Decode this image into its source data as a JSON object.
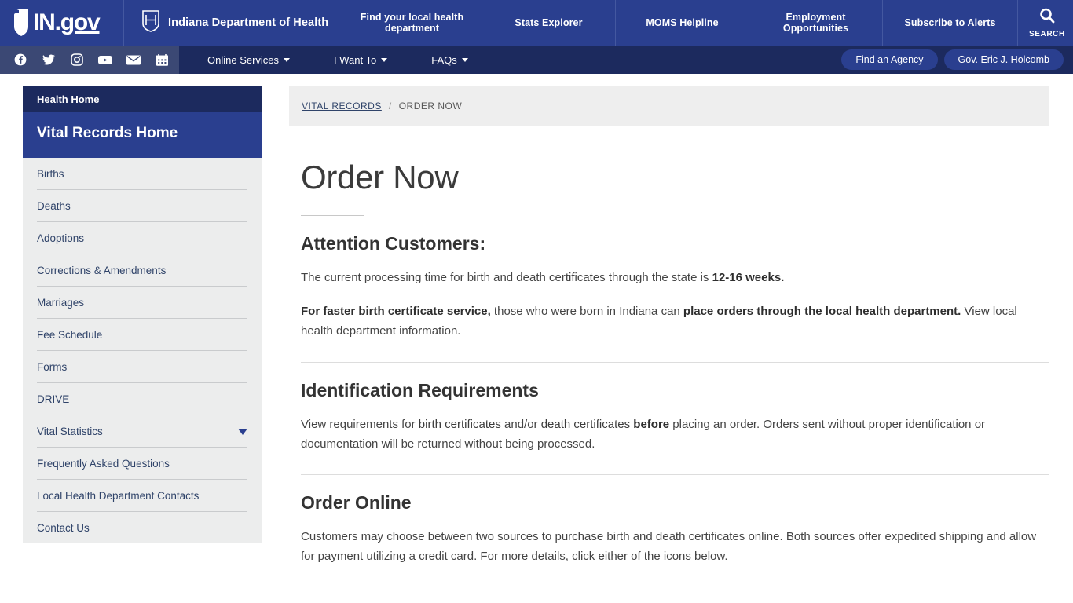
{
  "header": {
    "logo_text_in": "IN",
    "logo_text_dot": ".",
    "logo_text_gov": "gov",
    "agency_title": "Indiana Department of Health",
    "nav_items": [
      {
        "label": "Find your local health department"
      },
      {
        "label": "Stats Explorer"
      },
      {
        "label": "MOMS Helpline"
      },
      {
        "label": "Employment Opportunities"
      },
      {
        "label": "Subscribe to Alerts"
      }
    ],
    "search_label": "SEARCH"
  },
  "navbar": {
    "social_icons": [
      {
        "name": "facebook-icon"
      },
      {
        "name": "twitter-icon"
      },
      {
        "name": "instagram-icon"
      },
      {
        "name": "youtube-icon"
      },
      {
        "name": "email-icon"
      },
      {
        "name": "calendar-icon"
      }
    ],
    "links": [
      {
        "label": "Online Services"
      },
      {
        "label": "I Want To"
      },
      {
        "label": "FAQs"
      }
    ],
    "buttons": [
      {
        "label": "Find an Agency"
      },
      {
        "label": "Gov. Eric J. Holcomb"
      }
    ]
  },
  "sidebar": {
    "health_home": "Health Home",
    "section_title": "Vital Records Home",
    "items": [
      {
        "label": "Births",
        "has_caret": false
      },
      {
        "label": "Deaths",
        "has_caret": false
      },
      {
        "label": "Adoptions",
        "has_caret": false
      },
      {
        "label": "Corrections & Amendments",
        "has_caret": false
      },
      {
        "label": "Marriages",
        "has_caret": false
      },
      {
        "label": "Fee Schedule",
        "has_caret": false
      },
      {
        "label": "Forms",
        "has_caret": false
      },
      {
        "label": "DRIVE",
        "has_caret": false
      },
      {
        "label": "Vital Statistics",
        "has_caret": true
      },
      {
        "label": "Frequently Asked Questions",
        "has_caret": false
      },
      {
        "label": "Local Health Department Contacts",
        "has_caret": false
      },
      {
        "label": "Contact Us",
        "has_caret": false
      }
    ]
  },
  "breadcrumb": {
    "parent": "VITAL RECORDS",
    "separator": "/",
    "current": "ORDER NOW"
  },
  "main": {
    "title": "Order Now",
    "attention": {
      "heading": "Attention Customers:",
      "p1_a": "The current processing time for birth and death certificates through the state is ",
      "p1_b": "12-16 weeks.",
      "p2_a": "For faster birth certificate service,",
      "p2_b": " those who were born in Indiana can ",
      "p2_c": "place orders through the local health department.",
      "p2_link": "View",
      "p2_d": " local health department information."
    },
    "identification": {
      "heading": "Identification Requirements",
      "p_a": "View requirements for ",
      "p_link1": "birth certificates",
      "p_b": " and/or ",
      "p_link2": "death certificates",
      "p_c": " ",
      "p_bold": "before",
      "p_d": " placing an order. Orders sent without proper identification or documentation will be returned without being processed."
    },
    "order_online": {
      "heading": "Order Online",
      "p": "Customers may choose between two sources to purchase birth and death certificates online. Both sources offer expedited shipping and allow for payment utilizing a credit card. For more details, click either of the icons below."
    }
  },
  "colors": {
    "header_blue": "#2a3f8f",
    "navbar_navy": "#1c2a5e",
    "social_strip": "#3b4874",
    "sidebar_bg": "#eceded",
    "breadcrumb_bg": "#eeeeee",
    "link_navy": "#2f4369"
  }
}
